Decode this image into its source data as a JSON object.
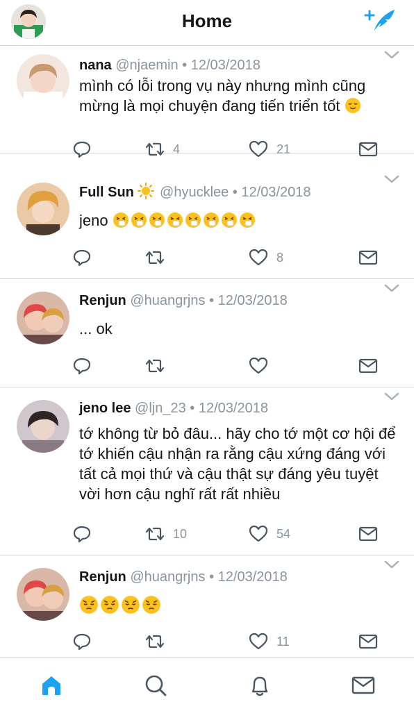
{
  "header": {
    "title": "Home",
    "compose_icon": "compose-feather-icon",
    "accent_color": "#1da1f2"
  },
  "tweets": [
    {
      "name": "nana",
      "handle": "@njaemin",
      "separator": "•",
      "date": "12/03/2018",
      "text": "mình có lỗi trong vụ này nhưng mình cũng mừng là mọi chuyện đang tiến triển tốt",
      "emojis": [
        "relieved"
      ],
      "retweets": "4",
      "likes": "21"
    },
    {
      "name": "Full Sun",
      "name_emoji": "sun",
      "handle": "@hyucklee",
      "separator": "•",
      "date": "12/03/2018",
      "text": "jeno",
      "emojis": [
        "sneezing",
        "sneezing",
        "sneezing",
        "sneezing",
        "sneezing",
        "sneezing",
        "sneezing",
        "sneezing"
      ],
      "retweets": "",
      "likes": "8"
    },
    {
      "name": "Renjun",
      "handle": "@huangrjns",
      "separator": "•",
      "date": "12/03/2018",
      "text": "... ok",
      "emojis": [],
      "retweets": "",
      "likes": ""
    },
    {
      "name": "jeno lee",
      "handle": "@ljn_23",
      "separator": "•",
      "date": "12/03/2018",
      "text": "tớ không từ bỏ đâu... hãy cho tớ một cơ hội để tớ khiến cậu nhận ra  rằng cậu xứng đáng với tất cả mọi thứ và cậu thật sự đáng yêu tuyệt vời hơn cậu nghĩ rất rất nhiều",
      "emojis": [],
      "retweets": "10",
      "likes": "54"
    },
    {
      "name": "Renjun",
      "handle": "@huangrjns",
      "separator": "•",
      "date": "12/03/2018",
      "text": "",
      "emojis": [
        "pensive",
        "pensive",
        "pensive",
        "pensive"
      ],
      "retweets": "",
      "likes": "11"
    }
  ],
  "tabbar": {
    "items": [
      "home-icon",
      "search-icon",
      "notifications-bell-icon",
      "messages-mail-icon"
    ],
    "active": "home-icon"
  }
}
